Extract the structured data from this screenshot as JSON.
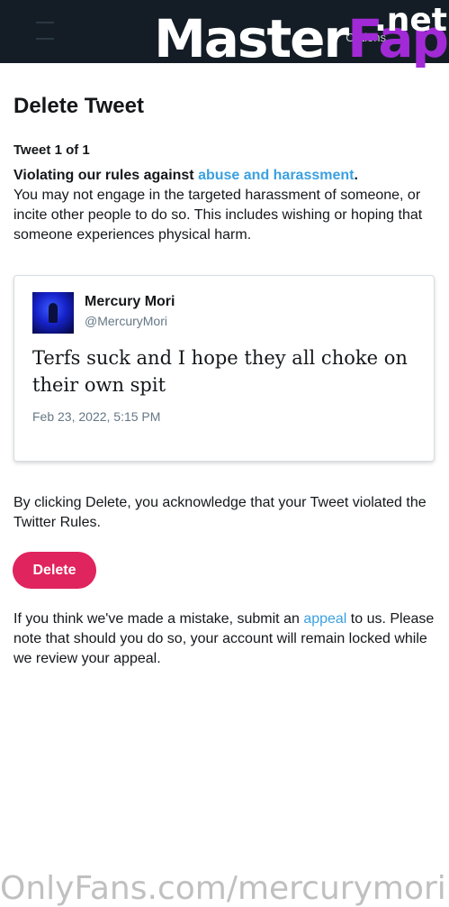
{
  "header": {
    "options_label": "Options"
  },
  "watermark_top": {
    "part_a": "Master",
    "part_b": "Fap",
    "suffix": ".net"
  },
  "page": {
    "title": "Delete Tweet",
    "tweet_count": "Tweet 1 of 1",
    "violation_prefix": "Violating our rules against ",
    "violation_link": "abuse and harassment",
    "violation_suffix": ".",
    "violation_description": "You may not engage in the targeted harassment of someone, or incite other people to do so. This includes wishing or hoping that someone experiences physical harm."
  },
  "tweet": {
    "author_name": "Mercury Mori",
    "author_handle": "@MercuryMori",
    "text": "Terfs suck and I hope they all choke on their own spit",
    "timestamp": "Feb 23, 2022, 5:15 PM"
  },
  "acknowledgement": "By clicking Delete, you acknowledge that your Tweet violated the Twitter Rules.",
  "delete_button_label": "Delete",
  "appeal": {
    "prefix": "If you think we've made a mistake, submit an ",
    "link": "appeal",
    "suffix": " to us. Please note that should you do so, your account will remain locked while we review your appeal."
  },
  "watermark_bottom": "OnlyFans.com/mercurymori",
  "colors": {
    "topbar": "#141d26",
    "link": "#3aa0e0",
    "delete_button": "#e0245e",
    "secondary_text": "#657786"
  }
}
